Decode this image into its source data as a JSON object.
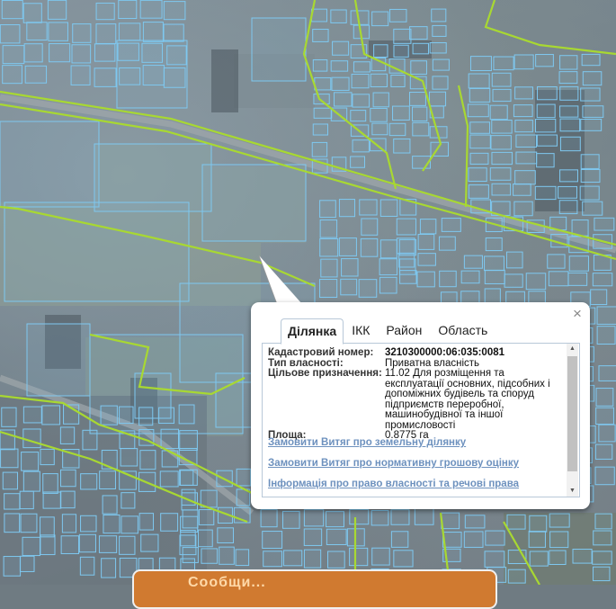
{
  "popup": {
    "tabs": [
      {
        "label": "Ділянка",
        "active": true
      },
      {
        "label": "ІКК",
        "active": false
      },
      {
        "label": "Район",
        "active": false
      },
      {
        "label": "Область",
        "active": false
      }
    ],
    "close_icon": "close-icon",
    "fields": [
      {
        "label": "Кадастровий номер:",
        "value": "3210300000:06:035:0081",
        "bold": true
      },
      {
        "label": "Тип власності:",
        "value": "Приватна власність"
      },
      {
        "label": "Цільове призначення:",
        "value": "11.02 Для розміщення та експлуатації основних, підсобних і допоміжних будівель та споруд підприємств переробної, машинобудівної та іншої промисловості"
      },
      {
        "label": "Площа:",
        "value": "0.8775 га"
      }
    ],
    "links": [
      "Замовити Витяг про земельну ділянку",
      "Замовити Витяг про нормативну грошову оцінку",
      "Інформація про право власності та речові права"
    ]
  },
  "banner": {
    "text": "Сообщи..."
  },
  "colors": {
    "parcel": "#7ec8f0",
    "boundary": "#a8d832",
    "link": "#6d91be"
  }
}
